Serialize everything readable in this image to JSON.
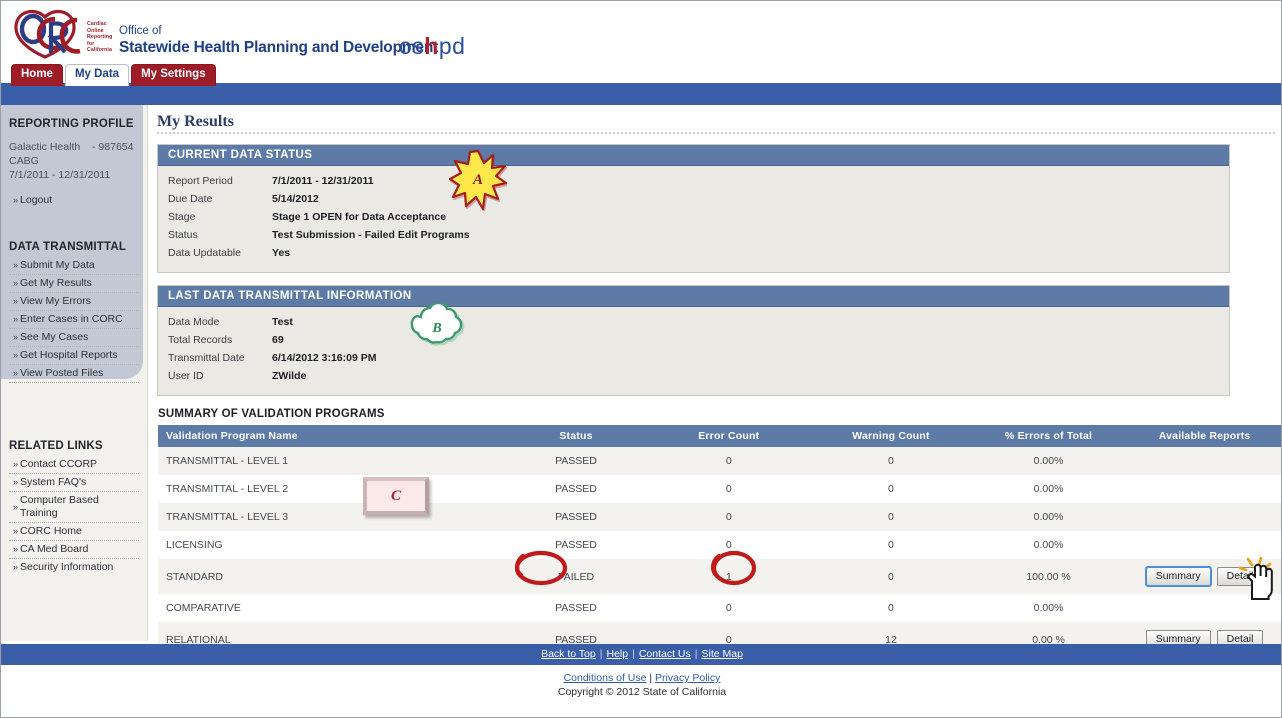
{
  "header": {
    "logo_text": "CORC",
    "logo_subtitle_lines": [
      "Cardiac",
      "Online",
      "Reporting",
      "for",
      "California"
    ],
    "office_of": "Office of",
    "department": "Statewide Health Planning and Development",
    "oshpd_os": "os",
    "oshpd_h": "h",
    "oshpd_pd": "pd"
  },
  "tabs": [
    {
      "label": "Home",
      "active": false
    },
    {
      "label": "My Data",
      "active": true
    },
    {
      "label": "My Settings",
      "active": false
    }
  ],
  "sidebar": {
    "reporting_profile_heading": "REPORTING PROFILE",
    "org_name": "Galactic Health",
    "org_dash": "-",
    "org_id": "987654",
    "program": "CABG",
    "period": "7/1/2011 - 12/31/2011",
    "logout_label": "Logout",
    "data_transmittal_heading": "DATA TRANSMITTAL",
    "data_transmittal_items": [
      "Submit My Data",
      "Get My Results",
      "View My Errors",
      "Enter Cases in CORC",
      "See My Cases",
      "Get Hospital Reports",
      "View Posted Files"
    ],
    "related_links_heading": "RELATED LINKS",
    "related_links_items": [
      "Contact CCORP",
      "System FAQ's",
      "Computer Based Training",
      "CORC Home",
      "CA Med Board",
      "Security Information"
    ]
  },
  "main": {
    "page_title": "My Results",
    "current_status": {
      "heading": "CURRENT DATA STATUS",
      "rows": [
        {
          "key": "Report Period",
          "value": "7/1/2011 - 12/31/2011"
        },
        {
          "key": "Due Date",
          "value": "5/14/2012"
        },
        {
          "key": "Stage",
          "value": "Stage 1 OPEN for Data Acceptance"
        },
        {
          "key": "Status",
          "value": "Test Submission - Failed Edit Programs"
        },
        {
          "key": "Data Updatable",
          "value": "Yes"
        }
      ]
    },
    "last_transmittal": {
      "heading": "LAST DATA TRANSMITTAL INFORMATION",
      "rows": [
        {
          "key": "Data Mode",
          "value": "Test"
        },
        {
          "key": "Total Records",
          "value": "69"
        },
        {
          "key": "Transmittal Date",
          "value": "6/14/2012  3:16:09 PM"
        },
        {
          "key": "User ID",
          "value": "ZWilde"
        }
      ]
    },
    "summary": {
      "title": "SUMMARY OF VALIDATION PROGRAMS",
      "columns": [
        "Validation Program Name",
        "Status",
        "Error Count",
        "Warning Count",
        "% Errors of Total",
        "Available Reports"
      ],
      "rows": [
        {
          "name": "TRANSMITTAL - LEVEL 1",
          "name_link": false,
          "status": "PASSED",
          "status_link": false,
          "errors": "0",
          "warnings": "0",
          "pct": "0.00%",
          "reports": []
        },
        {
          "name": "TRANSMITTAL - LEVEL 2",
          "name_link": true,
          "status": "PASSED",
          "status_link": true,
          "errors": "0",
          "warnings": "0",
          "pct": "0.00%",
          "reports": []
        },
        {
          "name": "TRANSMITTAL - LEVEL 3",
          "name_link": false,
          "status": "PASSED",
          "status_link": false,
          "errors": "0",
          "warnings": "0",
          "pct": "0.00%",
          "reports": []
        },
        {
          "name": "LICENSING",
          "name_link": true,
          "status": "PASSED",
          "status_link": true,
          "errors": "0",
          "warnings": "0",
          "pct": "0.00%",
          "reports": []
        },
        {
          "name": "STANDARD",
          "name_link": false,
          "status": "FAILED",
          "status_link": false,
          "errors": "1",
          "warnings": "0",
          "pct": "100.00 %",
          "reports": [
            "Summary",
            "Detail"
          ],
          "focused_button": "Summary"
        },
        {
          "name": "COMPARATIVE",
          "name_link": true,
          "status": "PASSED",
          "status_link": true,
          "errors": "0",
          "warnings": "0",
          "pct": "0.00%",
          "reports": []
        },
        {
          "name": "RELATIONAL",
          "name_link": false,
          "status": "PASSED",
          "status_link": false,
          "errors": "0",
          "warnings": "12",
          "pct": "0.00 %",
          "reports": [
            "Summary",
            "Detail"
          ]
        }
      ]
    }
  },
  "footer": {
    "links": [
      "Back to Top",
      "Help",
      "Contact Us",
      "Site Map"
    ],
    "separator": "|",
    "conditions": "Conditions of Use",
    "privacy": "Privacy Policy",
    "copyright": "Copyright © 2012 State of California"
  },
  "annotations": [
    {
      "id": "A",
      "shape": "starburst",
      "label": "A",
      "fill": "#ffe84a",
      "stroke": "#a51e1e"
    },
    {
      "id": "B",
      "shape": "cloud",
      "label": "B",
      "fill": "#ffffff",
      "stroke": "#3f9b6e"
    },
    {
      "id": "C",
      "shape": "rectangle",
      "label": "C",
      "fill": "#fbe9ea",
      "stroke": "#b5202a"
    }
  ],
  "highlights": [
    {
      "target": "status-failed",
      "shape": "circle",
      "color": "#c01a1a"
    },
    {
      "target": "error-count-1",
      "shape": "circle",
      "color": "#c01a1a"
    }
  ],
  "cursor": {
    "type": "clicking-hand",
    "target": "detail-button-standard"
  }
}
